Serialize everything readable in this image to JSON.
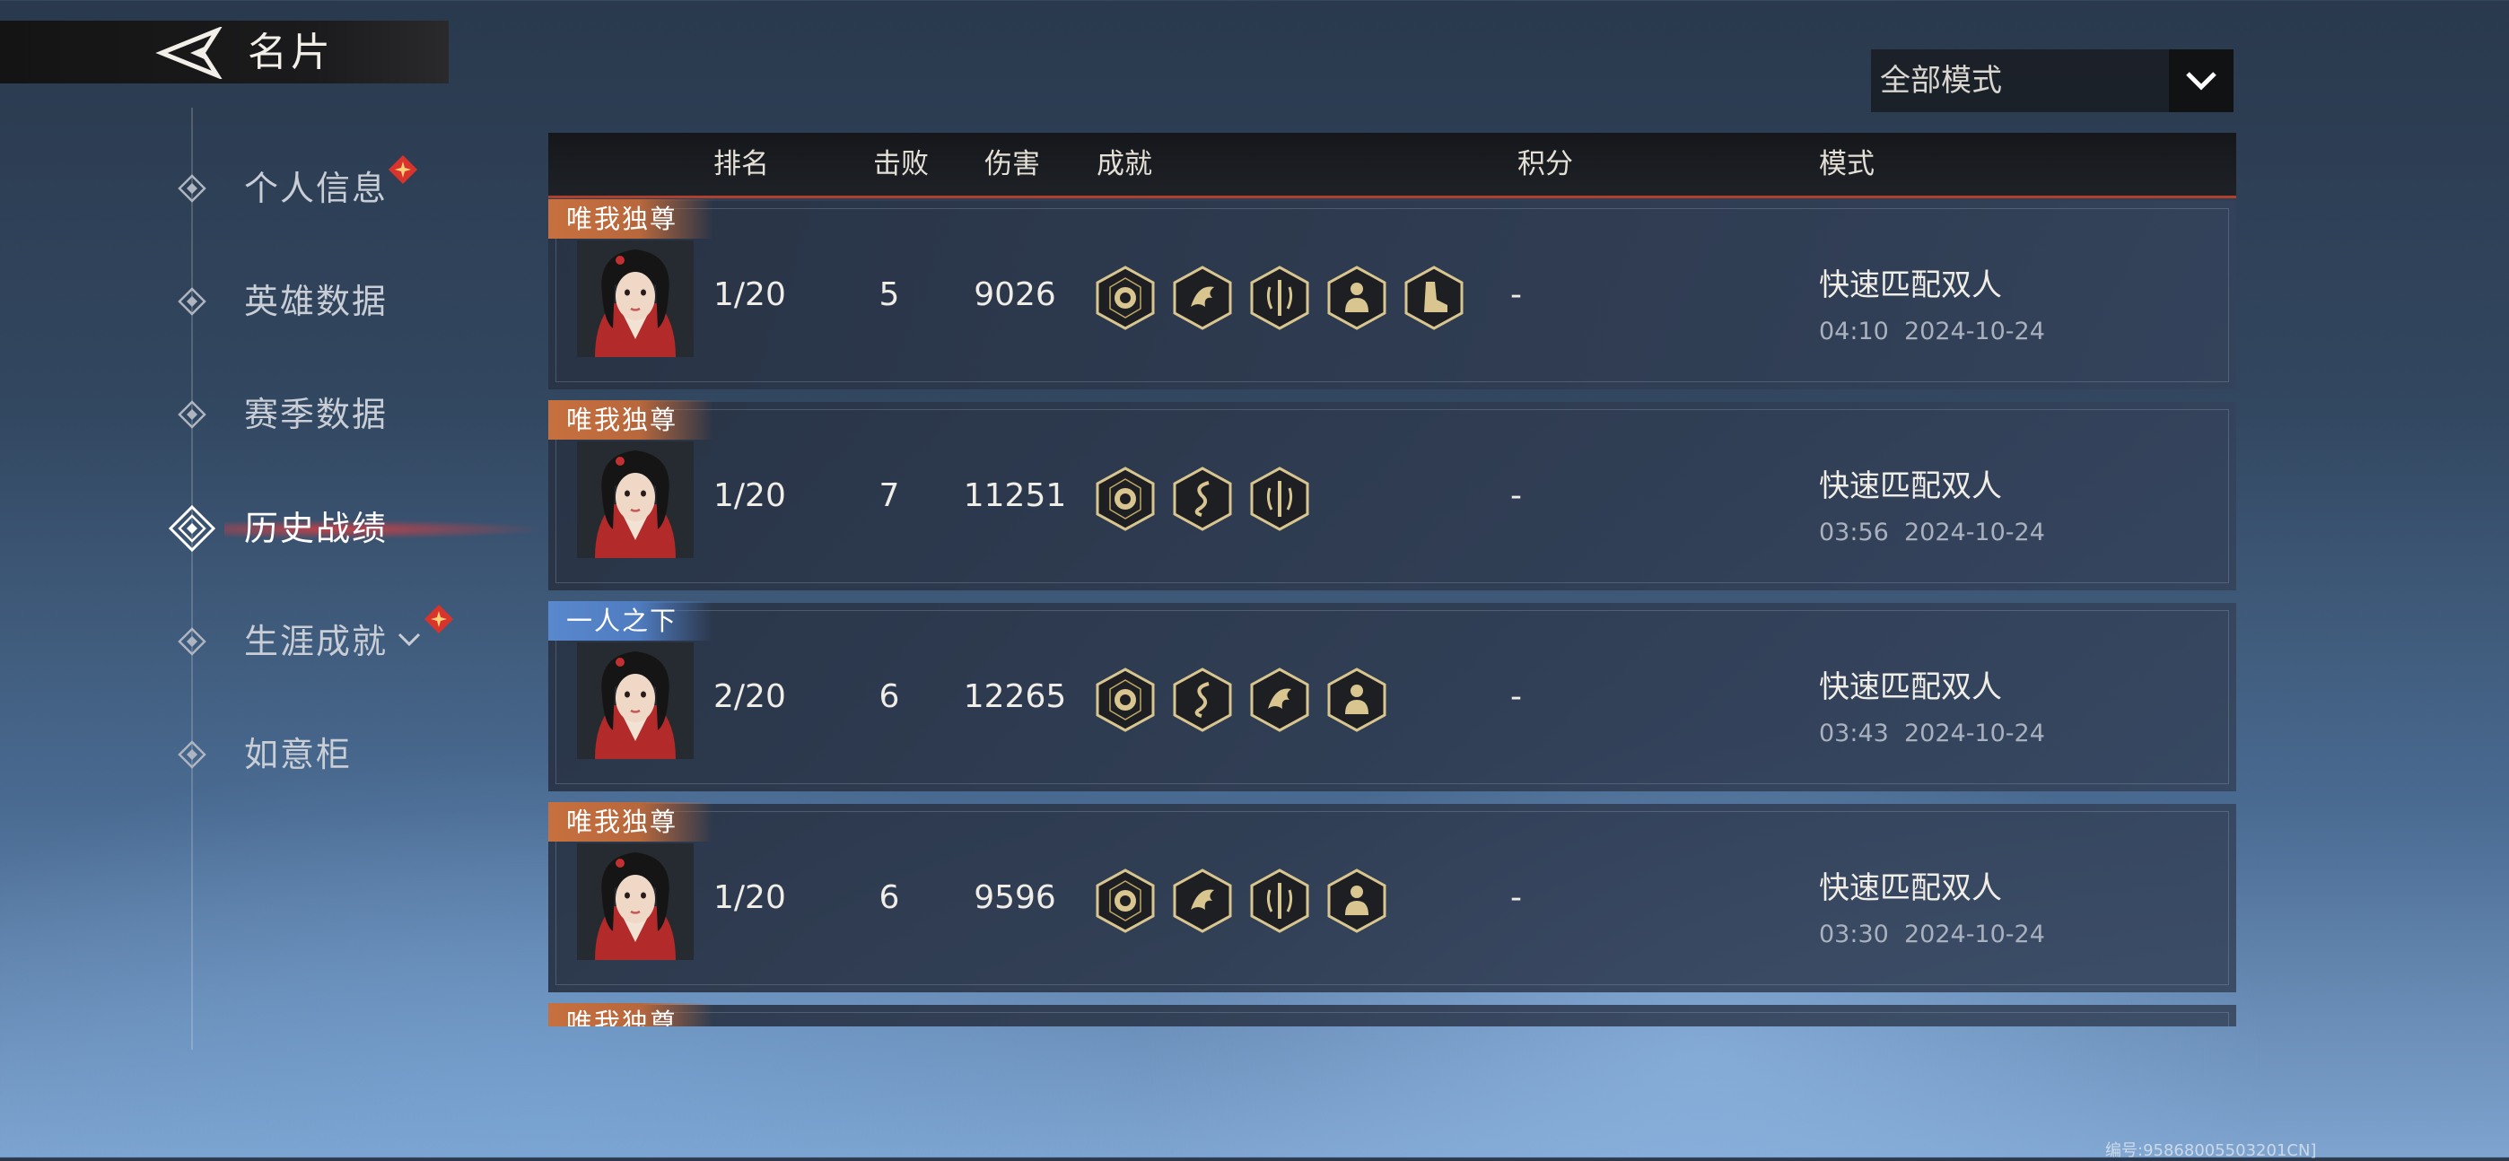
{
  "header": {
    "title": "名片",
    "back_icon": "back-arrow-icon"
  },
  "nav": {
    "items": [
      {
        "label": "个人信息",
        "badge": true,
        "active": false
      },
      {
        "label": "英雄数据",
        "badge": false,
        "active": false
      },
      {
        "label": "赛季数据",
        "badge": false,
        "active": false
      },
      {
        "label": "历史战绩",
        "badge": false,
        "active": true
      },
      {
        "label": "生涯成就",
        "badge": true,
        "active": false,
        "expandable": true
      },
      {
        "label": "如意柜",
        "badge": false,
        "active": false
      }
    ]
  },
  "mode_filter": {
    "value": "全部模式",
    "icon": "chevron-down-icon"
  },
  "table": {
    "headers": {
      "rank": "排名",
      "kills": "击败",
      "damage": "伤害",
      "achievements": "成就",
      "score": "积分",
      "mode": "模式"
    },
    "rows": [
      {
        "tag": "唯我独尊",
        "tag_color": "gold",
        "rank": "1/20",
        "kills": "5",
        "damage": "9026",
        "achievements": [
          "lion-head-badge-icon",
          "dragon-badge-icon",
          "sword-badge-icon",
          "warrior-badge-icon",
          "boot-badge-icon"
        ],
        "score": "-",
        "mode": "快速匹配双人",
        "time": "04:10  2024-10-24"
      },
      {
        "tag": "唯我独尊",
        "tag_color": "gold",
        "rank": "1/20",
        "kills": "7",
        "damage": "11251",
        "achievements": [
          "lion-head-badge-icon",
          "serpent-badge-icon",
          "sword-badge-icon"
        ],
        "score": "-",
        "mode": "快速匹配双人",
        "time": "03:56  2024-10-24"
      },
      {
        "tag": "一人之下",
        "tag_color": "blue",
        "rank": "2/20",
        "kills": "6",
        "damage": "12265",
        "achievements": [
          "lion-head-badge-icon",
          "serpent-badge-icon",
          "dragon-badge-icon",
          "warrior-badge-icon"
        ],
        "score": "-",
        "mode": "快速匹配双人",
        "time": "03:43  2024-10-24"
      },
      {
        "tag": "唯我独尊",
        "tag_color": "gold",
        "rank": "1/20",
        "kills": "6",
        "damage": "9596",
        "achievements": [
          "lion-head-badge-icon",
          "dragon-badge-icon",
          "sword-badge-icon",
          "warrior-badge-icon"
        ],
        "score": "-",
        "mode": "快速匹配双人",
        "time": "03:30  2024-10-24"
      },
      {
        "tag": "唯我独尊",
        "tag_color": "gold"
      }
    ]
  },
  "footer": {
    "id_text": "编号:95868005503201CN]"
  }
}
